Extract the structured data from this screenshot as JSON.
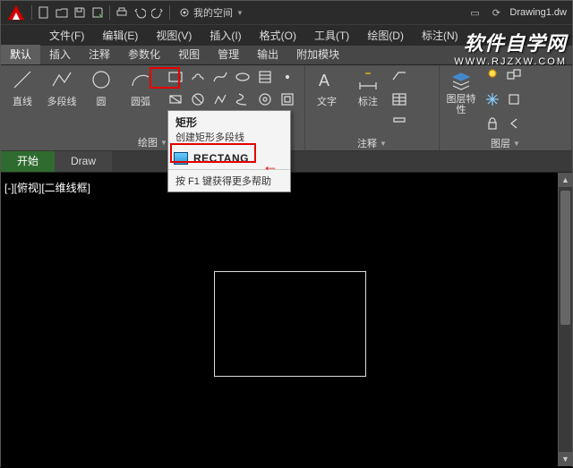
{
  "qat": {
    "workspace_label": "我的空间",
    "doc_title": "Drawing1.dw"
  },
  "menubar": {
    "items": [
      "文件(F)",
      "编辑(E)",
      "视图(V)",
      "插入(I)",
      "格式(O)",
      "工具(T)",
      "绘图(D)",
      "标注(N)"
    ]
  },
  "ribbon_tabs": {
    "items": [
      "默认",
      "插入",
      "注释",
      "参数化",
      "视图",
      "管理",
      "输出",
      "附加模块"
    ],
    "active_index": 0
  },
  "ribbon": {
    "draw": {
      "line": "直线",
      "polyline": "多段线",
      "circle": "圆",
      "arc": "圆弧",
      "panel_label": "绘图"
    },
    "annot": {
      "text": "文字",
      "dim": "标注",
      "table_icon": "table",
      "panel_label": "注释"
    },
    "layer": {
      "props": "图层特性",
      "panel_label": "图层"
    }
  },
  "doc_tabs": {
    "items": [
      "开始",
      "Draw"
    ],
    "active_index": 0
  },
  "canvas": {
    "viewport_label": "[-][俯视][二维线框]"
  },
  "tooltip": {
    "title": "矩形",
    "desc": "创建矩形多段线",
    "command": "RECTANG",
    "help": "按 F1 键获得更多帮助"
  },
  "watermark": {
    "line1": "软件自学网",
    "line2": "WWW.RJZXW.COM"
  }
}
